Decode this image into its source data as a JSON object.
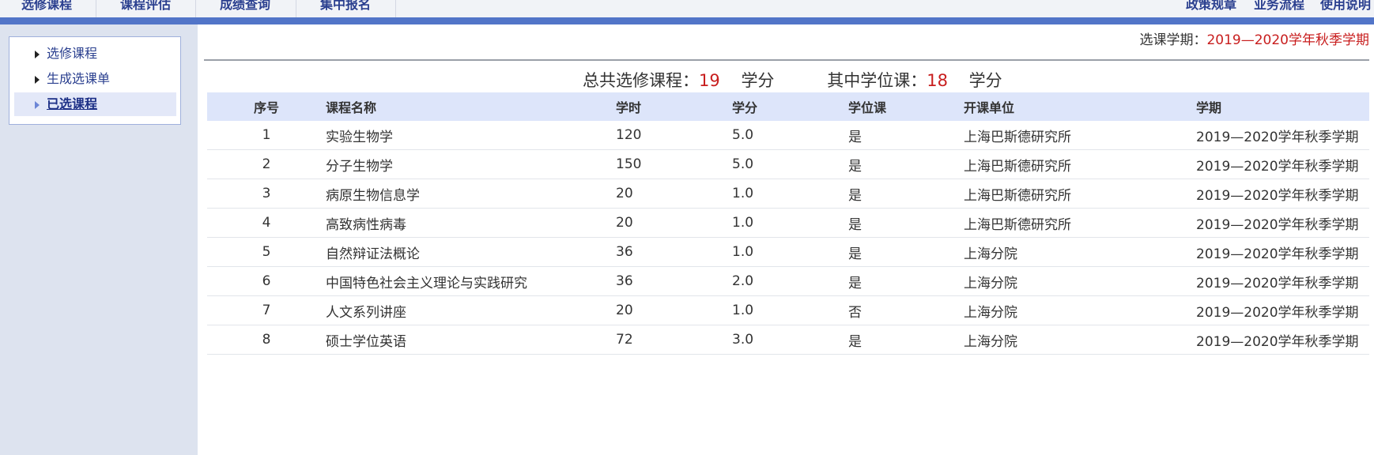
{
  "topnav": {
    "left_items": [
      "选修课程",
      "课程评估",
      "成绩查询",
      "集中报名"
    ],
    "right_items": [
      "政策规章",
      "业务流程",
      "使用说明"
    ]
  },
  "sidebar": {
    "items": [
      {
        "label": "选修课程",
        "active": false
      },
      {
        "label": "生成选课单",
        "active": false
      },
      {
        "label": "已选课程",
        "active": true
      }
    ]
  },
  "semester": {
    "label": "选课学期：",
    "value": "2019—2020学年秋季学期"
  },
  "summary": {
    "total_label": "总共选修课程：",
    "total_value": "19",
    "total_unit": "学分",
    "degree_label": "其中学位课：",
    "degree_value": "18",
    "degree_unit": "学分"
  },
  "table": {
    "columns": [
      "序号",
      "课程名称",
      "学时",
      "学分",
      "学位课",
      "开课单位",
      "学期"
    ],
    "rows": [
      [
        "1",
        "实验生物学",
        "120",
        "5.0",
        "是",
        "上海巴斯德研究所",
        "2019—2020学年秋季学期"
      ],
      [
        "2",
        "分子生物学",
        "150",
        "5.0",
        "是",
        "上海巴斯德研究所",
        "2019—2020学年秋季学期"
      ],
      [
        "3",
        "病原生物信息学",
        "20",
        "1.0",
        "是",
        "上海巴斯德研究所",
        "2019—2020学年秋季学期"
      ],
      [
        "4",
        "高致病性病毒",
        "20",
        "1.0",
        "是",
        "上海巴斯德研究所",
        "2019—2020学年秋季学期"
      ],
      [
        "5",
        "自然辩证法概论",
        "36",
        "1.0",
        "是",
        "上海分院",
        "2019—2020学年秋季学期"
      ],
      [
        "6",
        "中国特色社会主义理论与实践研究",
        "36",
        "2.0",
        "是",
        "上海分院",
        "2019—2020学年秋季学期"
      ],
      [
        "7",
        "人文系列讲座",
        "20",
        "1.0",
        "否",
        "上海分院",
        "2019—2020学年秋季学期"
      ],
      [
        "8",
        "硕士学位英语",
        "72",
        "3.0",
        "是",
        "上海分院",
        "2019—2020学年秋季学期"
      ]
    ]
  },
  "colors": {
    "nav_text": "#2a3f8f",
    "band": "#5275c8",
    "sidebar_bg": "#dde3ef",
    "header_bg": "#dde5fa",
    "highlight": "#c81e1e"
  }
}
